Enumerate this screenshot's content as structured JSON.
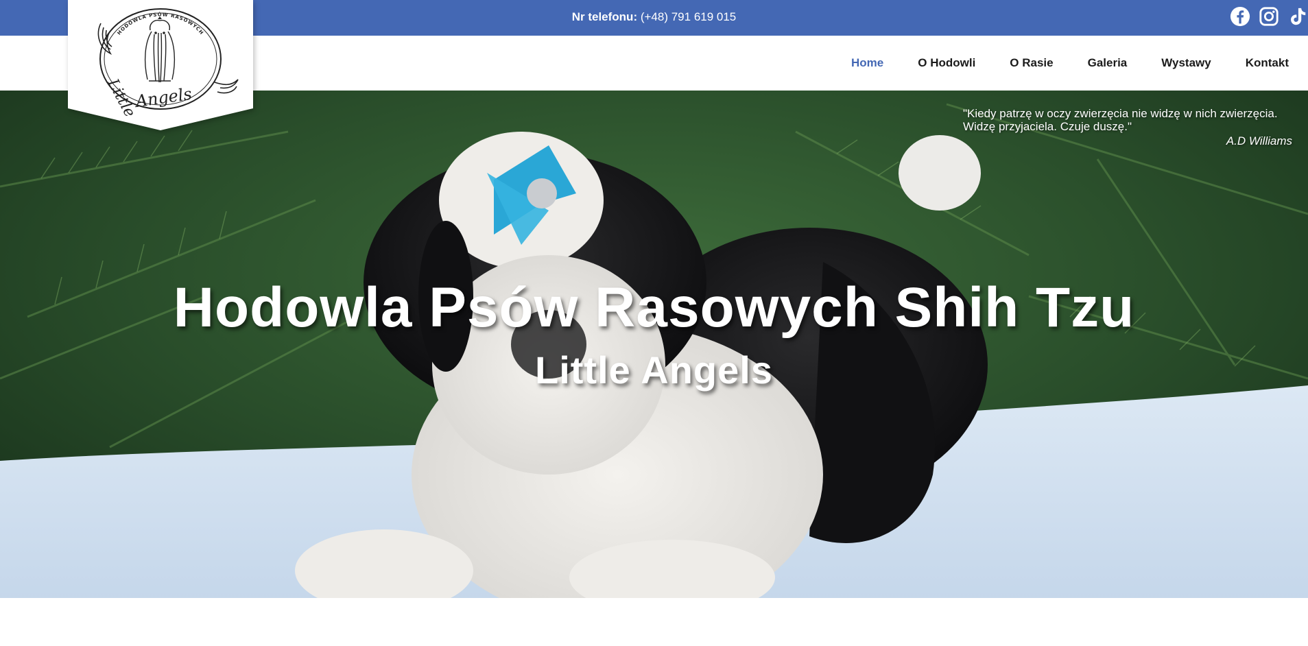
{
  "topbar": {
    "phone_label": "Nr telefonu:",
    "phone_number": "(+48) 791 619 015",
    "background_color": "#4468b4",
    "socials": [
      {
        "name": "facebook-icon"
      },
      {
        "name": "instagram-icon"
      },
      {
        "name": "tiktok-icon"
      }
    ]
  },
  "logo": {
    "arc_text": "HODOWLA PSÓW RASOWYCH",
    "script_text": "Little Angels"
  },
  "nav": {
    "items": [
      {
        "label": "Home",
        "active": true
      },
      {
        "label": "O Hodowli",
        "active": false
      },
      {
        "label": "O Rasie",
        "active": false
      },
      {
        "label": "Galeria",
        "active": false
      },
      {
        "label": "Wystawy",
        "active": false
      },
      {
        "label": "Kontakt",
        "active": false
      }
    ],
    "active_color": "#4468b4"
  },
  "hero": {
    "title": "Hodowla Psów Rasowych Shih Tzu",
    "subtitle": "Little Angels",
    "quote_line1": "\"Kiedy patrzę w oczy zwierzęcia nie widzę w nich zwierzęcia.",
    "quote_line2": "Widzę przyjaciela. Czuje duszę.\"",
    "quote_author": "A.D Williams"
  }
}
